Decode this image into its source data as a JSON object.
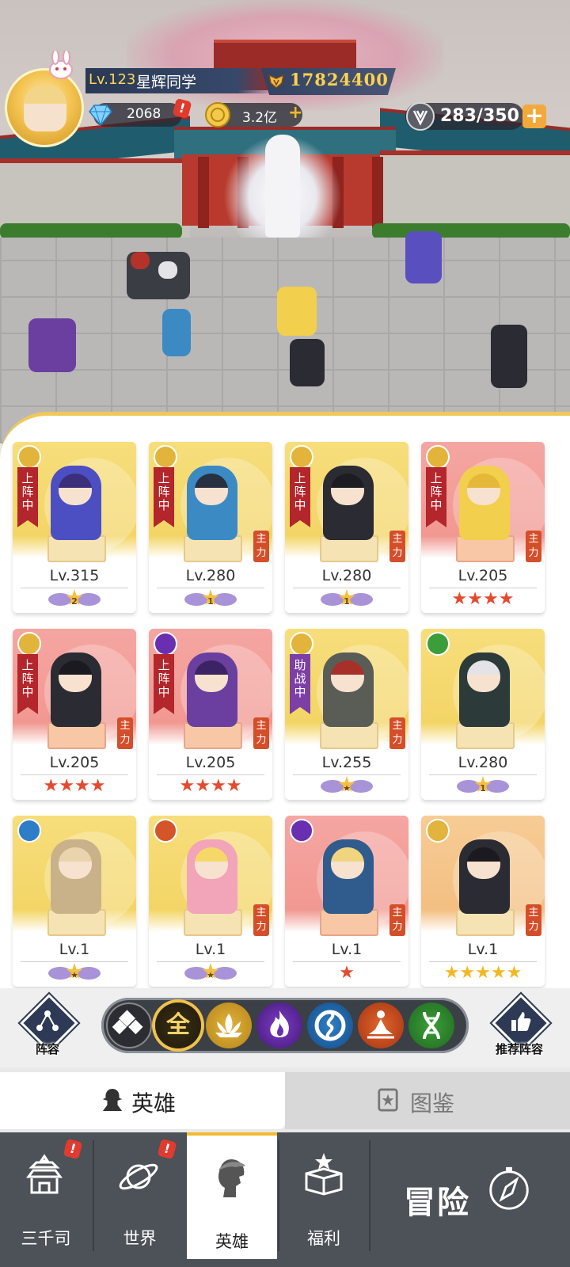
{
  "player": {
    "level": "Lv.123",
    "name": "星辉同学",
    "power": "17824400",
    "diamonds": "2068",
    "gold": "3.2亿",
    "stamina": "283/350"
  },
  "colors": {
    "accent_gold": "#f2bb2e",
    "card_yellow": "#f3d566",
    "card_red": "#f19891",
    "card_orange": "#f3bf82",
    "ribbon_red": "#b3262b",
    "ribbon_purple": "#7d3fa6"
  },
  "heroes": [
    {
      "level": "Lv.315",
      "status": "上阵中",
      "main": "",
      "faction": "lotus",
      "rarity": "yellow",
      "stars": "",
      "awaken": "2"
    },
    {
      "level": "Lv.280",
      "status": "上阵中",
      "main": "主力",
      "faction": "lotus",
      "rarity": "yellow",
      "stars": "",
      "awaken": "1"
    },
    {
      "level": "Lv.280",
      "status": "上阵中",
      "main": "主力",
      "faction": "lotus",
      "rarity": "yellow",
      "stars": "",
      "awaken": "1"
    },
    {
      "level": "Lv.205",
      "status": "上阵中",
      "main": "主力",
      "faction": "lotus",
      "rarity": "red",
      "stars": "★★★★",
      "awaken": ""
    },
    {
      "level": "Lv.205",
      "status": "上阵中",
      "main": "主力",
      "faction": "lotus",
      "rarity": "red",
      "stars": "★★★★",
      "awaken": ""
    },
    {
      "level": "Lv.205",
      "status": "上阵中",
      "main": "主力",
      "faction": "flame",
      "rarity": "red",
      "stars": "★★★★",
      "awaken": ""
    },
    {
      "level": "Lv.255",
      "status": "助战中",
      "main": "主力",
      "faction": "lotus",
      "rarity": "yellow",
      "stars": "",
      "awaken": "★"
    },
    {
      "level": "Lv.280",
      "status": "",
      "main": "",
      "faction": "dna",
      "rarity": "yellow",
      "stars": "",
      "awaken": "1"
    },
    {
      "level": "Lv.1",
      "status": "",
      "main": "",
      "faction": "swirl",
      "rarity": "yellow",
      "stars": "",
      "awaken": "★"
    },
    {
      "level": "Lv.1",
      "status": "",
      "main": "主力",
      "faction": "meditate",
      "rarity": "yellow",
      "stars": "",
      "awaken": "★"
    },
    {
      "level": "Lv.1",
      "status": "",
      "main": "主力",
      "faction": "flame",
      "rarity": "red",
      "stars": "★",
      "awaken": ""
    },
    {
      "level": "Lv.1",
      "status": "",
      "main": "主力",
      "faction": "lotus",
      "rarity": "orange",
      "stars": "★★★★★",
      "awaken": ""
    }
  ],
  "filter": {
    "lineup_label": "阵容",
    "recommend_label": "推荐阵容",
    "all_label": "全",
    "chips": [
      "all-classes",
      "all",
      "lotus",
      "flame",
      "swirl",
      "meditate",
      "dna"
    ]
  },
  "tabs": {
    "heroes": "英雄",
    "codex": "图鉴"
  },
  "nav": {
    "sanqiansi": "三千司",
    "world": "世界",
    "heroes": "英雄",
    "welfare": "福利",
    "adventure": "冒险"
  },
  "alerts": {
    "mark": "!"
  }
}
